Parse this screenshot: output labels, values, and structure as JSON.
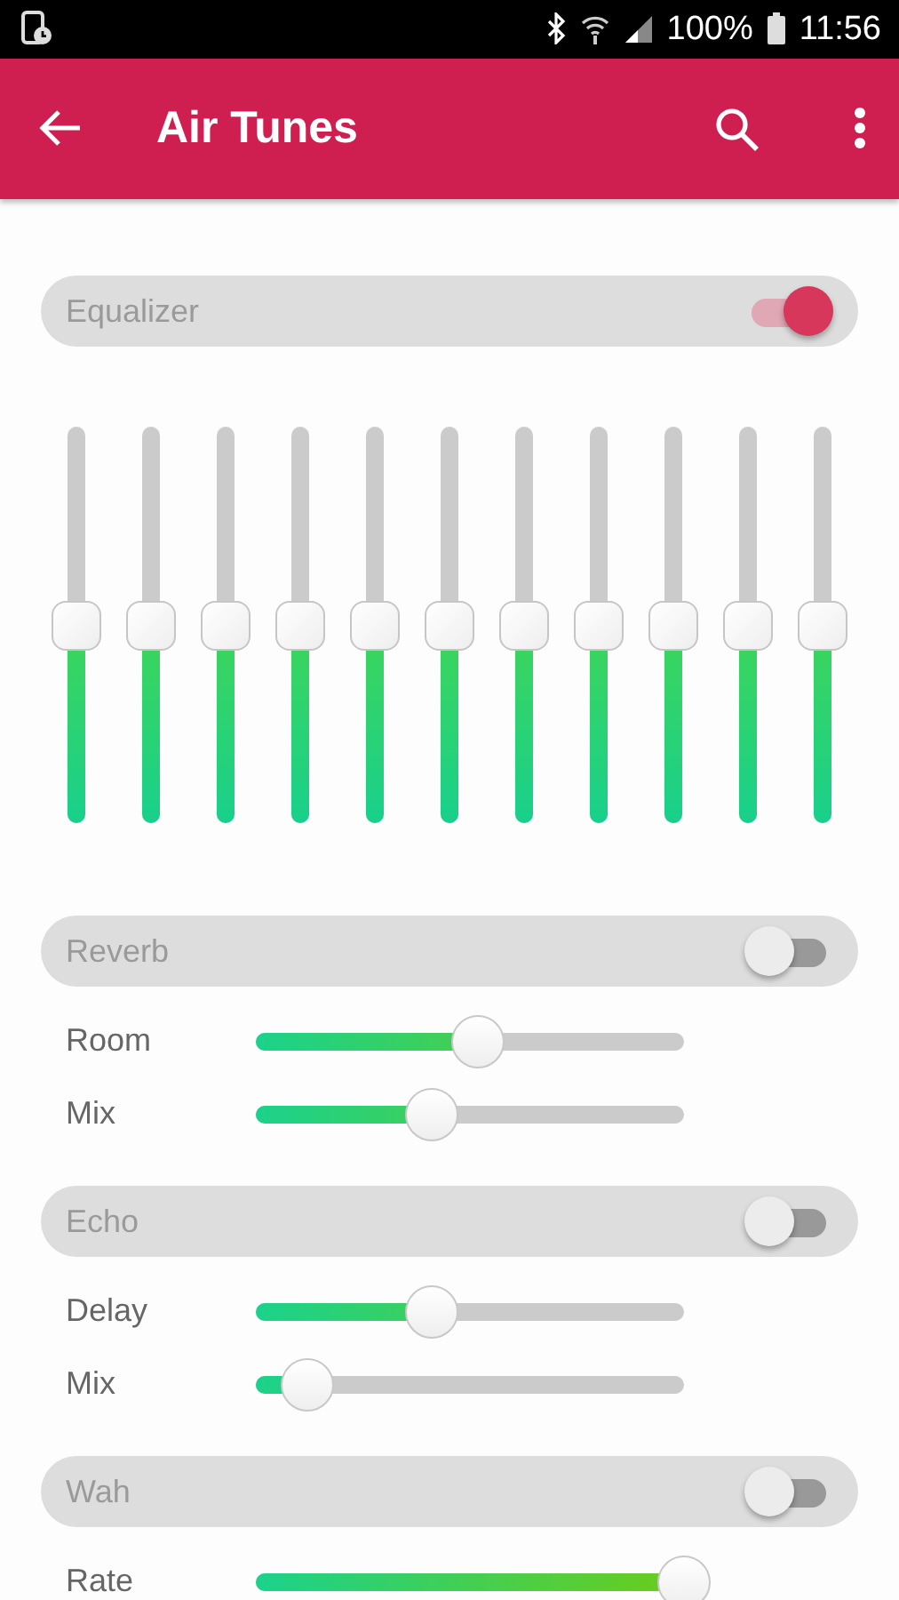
{
  "status_bar": {
    "battery": "100%",
    "time": "11:56"
  },
  "app_bar": {
    "title": "Air Tunes"
  },
  "sections": [
    {
      "kind": "equalizer",
      "title": "Equalizer",
      "on": true,
      "bands": [
        {
          "level": 0.5
        },
        {
          "level": 0.5
        },
        {
          "level": 0.5
        },
        {
          "level": 0.5
        },
        {
          "level": 0.5
        },
        {
          "level": 0.5
        },
        {
          "level": 0.5
        },
        {
          "level": 0.5
        },
        {
          "level": 0.5
        },
        {
          "level": 0.5
        },
        {
          "level": 0.5
        }
      ]
    },
    {
      "kind": "sliders",
      "title": "Reverb",
      "on": false,
      "controls": [
        {
          "label": "Room",
          "level": 0.52
        },
        {
          "label": "Mix",
          "level": 0.41
        }
      ]
    },
    {
      "kind": "sliders",
      "title": "Echo",
      "on": false,
      "controls": [
        {
          "label": "Delay",
          "level": 0.41
        },
        {
          "label": "Mix",
          "level": 0.12
        }
      ]
    },
    {
      "kind": "sliders",
      "title": "Wah",
      "on": false,
      "controls": [
        {
          "label": "Rate",
          "level": 1.0
        }
      ]
    }
  ]
}
